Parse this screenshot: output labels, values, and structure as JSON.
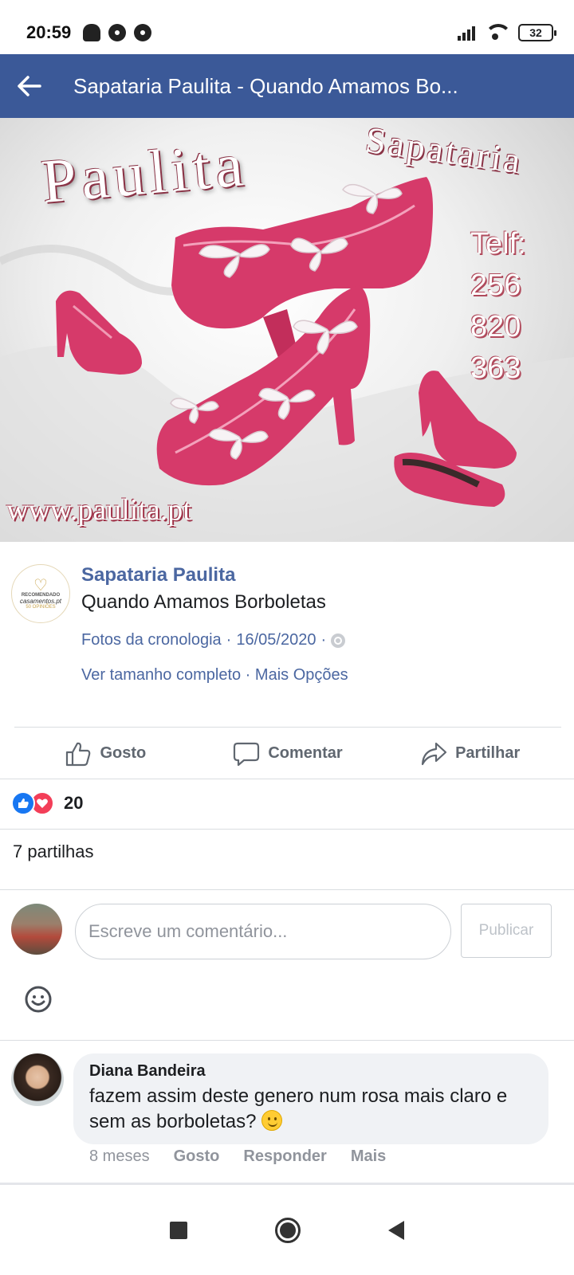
{
  "status_bar": {
    "time": "20:59",
    "battery": "32"
  },
  "header": {
    "title": "Sapataria Paulita - Quando Amamos Bo..."
  },
  "photo": {
    "brand": "Paulita",
    "subtitle": "Sapataria",
    "phone_label": "Telf:",
    "phone_1": "256",
    "phone_2": "820",
    "phone_3": "363",
    "url": "www.paulita.pt",
    "shoe_color": "#d63a6a"
  },
  "page_avatar": {
    "line1": "RECOMENDADO",
    "line2": "casamentos.pt",
    "line3": "50 OPINIÕES"
  },
  "post": {
    "page_name": "Sapataria Paulita",
    "text": "Quando Amamos Borboletas",
    "album": "Fotos da cronologia",
    "date": "16/05/2020",
    "separator": " · ",
    "link_full_size": "Ver tamanho completo",
    "link_more": "Mais Opções"
  },
  "actions": {
    "like": "Gosto",
    "comment": "Comentar",
    "share": "Partilhar"
  },
  "reactions": {
    "count": "20"
  },
  "shares": {
    "text": "7 partilhas"
  },
  "composer": {
    "placeholder": "Escreve um comentário...",
    "publish": "Publicar"
  },
  "comment": {
    "author": "Diana Bandeira",
    "text": "fazem assim deste genero num rosa mais claro e sem as borboletas?",
    "time": "8 meses",
    "like": "Gosto",
    "reply": "Responder",
    "more": "Mais"
  },
  "colors": {
    "brand_blue": "#3b5998",
    "link_blue": "#4b67a1",
    "like_blue": "#1877f2",
    "love_red": "#f33e58"
  }
}
